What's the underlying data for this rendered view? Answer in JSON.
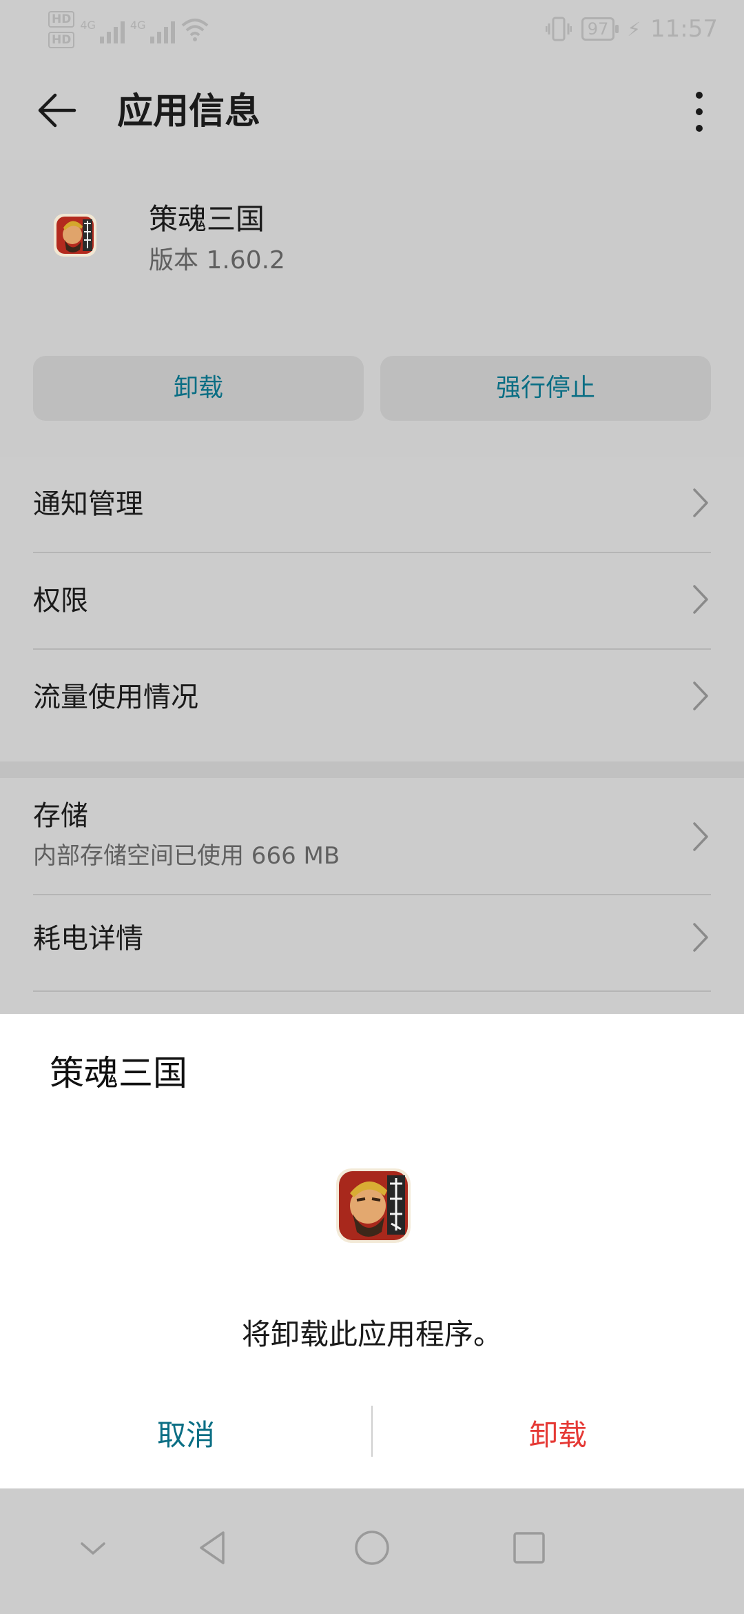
{
  "status_bar": {
    "hd1": "HD",
    "hd2": "HD",
    "net1": "4G",
    "net2": "4G",
    "battery": "97",
    "time": "11:57",
    "icons": [
      "vibrate-icon",
      "battery-icon",
      "charging-icon",
      "wifi-icon"
    ]
  },
  "top_bar": {
    "title": "应用信息",
    "icons": [
      "back-arrow-icon",
      "more-vertical-icon"
    ]
  },
  "app_header": {
    "name": "策魂三国",
    "version": "版本 1.60.2",
    "uninstall_label": "卸载",
    "force_stop_label": "强行停止"
  },
  "settings": {
    "rows": [
      {
        "label": "通知管理"
      },
      {
        "label": "权限"
      },
      {
        "label": "流量使用情况"
      }
    ],
    "storage": {
      "title": "存储",
      "subtitle": "内部存储空间已使用 666 MB"
    },
    "battery_details": {
      "label": "耗电详情"
    }
  },
  "dialog": {
    "title": "策魂三国",
    "message": "将卸载此应用程序。",
    "cancel_label": "取消",
    "confirm_label": "卸载"
  },
  "nav_bar": {
    "icons": [
      "collapse-icon",
      "back-triangle-icon",
      "home-circle-icon",
      "recents-square-icon"
    ]
  },
  "colors": {
    "accent": "#0a6e84",
    "danger": "#e53935",
    "dim_background": "#cccccc",
    "dialog_background": "#ffffff"
  }
}
